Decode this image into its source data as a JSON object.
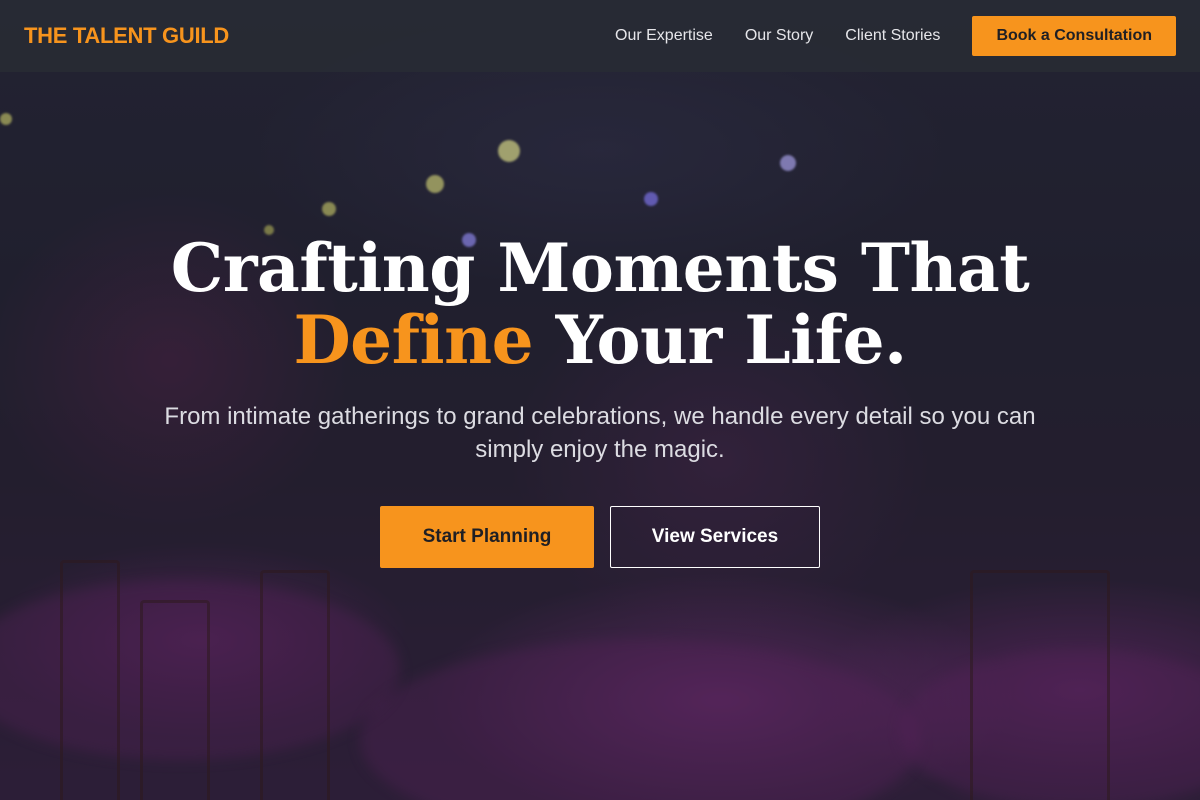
{
  "nav": {
    "brand": "THE TALENT GUILD",
    "links": [
      "Our Expertise",
      "Our Story",
      "Client Stories"
    ],
    "cta_label": "Book a Consultation"
  },
  "hero": {
    "title_line1": "Crafting Moments That",
    "title_accent": "Define",
    "title_rest": " Your Life.",
    "subtitle": "From intimate gatherings to grand celebrations, we handle every detail so you can simply enjoy the magic.",
    "primary_button": "Start Planning",
    "secondary_button": "View Services"
  },
  "colors": {
    "accent": "#f7941d",
    "navbar_bg": "#282c34",
    "text_primary": "#ffffff"
  }
}
